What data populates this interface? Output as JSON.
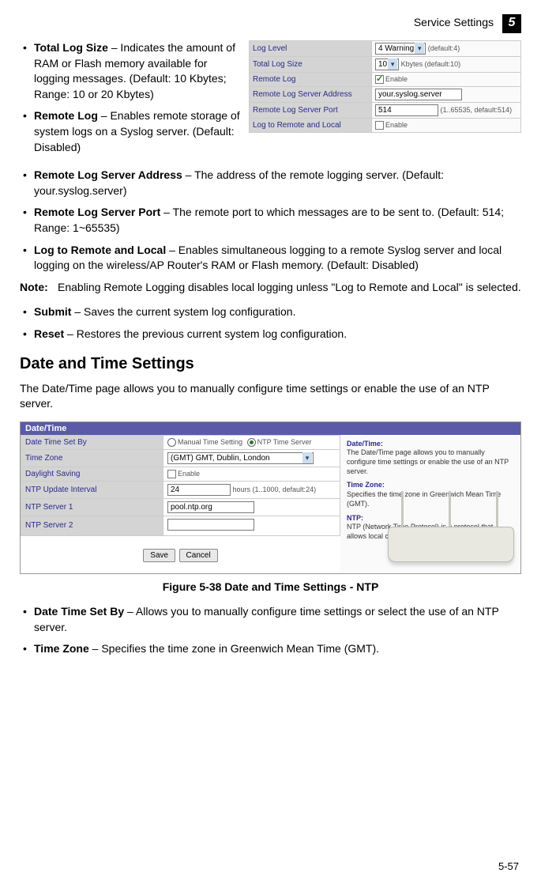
{
  "header": {
    "section": "Service Settings",
    "chapter": "5"
  },
  "bullets_top": [
    {
      "term": "Total Log Size",
      "desc": " – Indicates the amount of RAM or Flash memory available for logging messages. (Default: 10 Kbytes; Range: 10 or 20 Kbytes)"
    },
    {
      "term": "Remote Log",
      "desc": " – Enables remote storage of system logs on a Syslog server. (Default: Disabled)"
    },
    {
      "term": "Remote Log Server Address",
      "desc": " – The address of the remote logging server. (Default: your.syslog.server)"
    },
    {
      "term": "Remote Log Server Port",
      "desc": " – The remote port to which messages are to be sent to. (Default: 514; Range: 1~65535)"
    },
    {
      "term": "Log to Remote and Local",
      "desc": " – Enables simultaneous logging to a remote Syslog server and local logging on the wireless/AP Router's RAM or Flash memory. (Default: Disabled)"
    }
  ],
  "note": {
    "label": "Note:",
    "text": "Enabling Remote Logging disables local logging unless \"Log to Remote and Local\" is selected."
  },
  "bullets_mid": [
    {
      "term": "Submit",
      "desc": " – Saves the current system log configuration."
    },
    {
      "term": "Reset",
      "desc": " – Restores the previous current system log configuration."
    }
  ],
  "h2": "Date and Time Settings",
  "intro_para": "The Date/Time page allows you to manually configure time settings or enable the use of an NTP server.",
  "syslog_table": {
    "rows": [
      {
        "label": "Log Level",
        "value": "4 Warning",
        "suffix": " (default:4)",
        "type": "select"
      },
      {
        "label": "Total Log Size",
        "value": "10",
        "suffix": " Kbytes (default:10)",
        "type": "select"
      },
      {
        "label": "Remote Log",
        "value": "Enable",
        "type": "checkbox",
        "checked": true
      },
      {
        "label": "Remote Log Server Address",
        "value": "your.syslog.server",
        "type": "input"
      },
      {
        "label": "Remote Log Server Port",
        "value": "514",
        "suffix": " (1..65535, default:514)",
        "type": "input"
      },
      {
        "label": "Log to Remote and Local",
        "value": "Enable",
        "type": "checkbox",
        "checked": false
      }
    ]
  },
  "datetime": {
    "title": "Date/Time",
    "rows": {
      "setby_label": "Date Time Set By",
      "setby_opt1": "Manual Time Setting",
      "setby_opt2": "NTP Time Server",
      "tz_label": "Time Zone",
      "tz_value": "(GMT) GMT, Dublin, London",
      "ds_label": "Daylight Saving",
      "ds_value": "Enable",
      "upd_label": "NTP Update Interval",
      "upd_value": "24",
      "upd_suffix": " hours (1..1000, default:24)",
      "s1_label": "NTP Server 1",
      "s1_value": "pool.ntp.org",
      "s2_label": "NTP Server 2",
      "s2_value": ""
    },
    "buttons": {
      "save": "Save",
      "cancel": "Cancel"
    },
    "help": {
      "dt_h": "Date/Time:",
      "dt_t": "The Date/Time page allows you to manually configure time settings or enable the use of an NTP server.",
      "tz_h": "Time Zone:",
      "tz_t": "Specifies the time zone in Greenwich Mean Time (GMT).",
      "ntp_h": "NTP:",
      "ntp_t": "NTP (Network Time Protocol) is a protocol that allows local computers to synchronize the clocks."
    }
  },
  "figure_caption": "Figure 5-38  Date and Time Settings - NTP",
  "bullets_bottom": [
    {
      "term": "Date Time Set By",
      "desc": " – Allows you to manually configure time settings or select the use of an NTP server."
    },
    {
      "term": "Time Zone",
      "desc": " – Specifies the time zone in Greenwich Mean Time (GMT)."
    }
  ],
  "page_num": "5-57"
}
